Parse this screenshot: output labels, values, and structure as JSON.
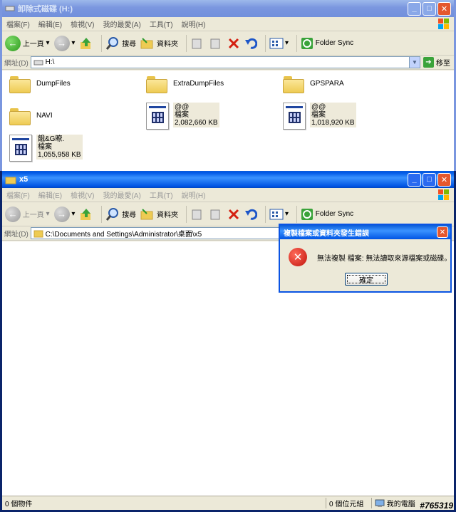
{
  "window1": {
    "title": "卸除式磁碟 (H:)",
    "menu": [
      "檔案(F)",
      "編輯(E)",
      "檢視(V)",
      "我的最愛(A)",
      "工具(T)",
      "說明(H)"
    ],
    "toolbar": {
      "back": "上一頁",
      "search": "搜尋",
      "folders": "資料夾",
      "folder_sync": "Folder Sync"
    },
    "address_label": "網址(D)",
    "address_value": "H:\\",
    "go_label": "移至",
    "items": [
      {
        "type": "folder",
        "name": "DumpFiles"
      },
      {
        "type": "folder",
        "name": "ExtraDumpFiles"
      },
      {
        "type": "folder",
        "name": "GPSPARA"
      },
      {
        "type": "folder",
        "name": "NAVI"
      },
      {
        "type": "file",
        "name": "@@",
        "kind": "檔案",
        "size": "2,082,660 KB"
      },
      {
        "type": "file",
        "name": "@@",
        "kind": "檔案",
        "size": "1,018,920 KB"
      },
      {
        "type": "file",
        "name": "餓&G瞭.",
        "kind": "檔案",
        "size": "1,055,958 KB"
      }
    ]
  },
  "window2": {
    "title": "x5",
    "menu": [
      "檔案(F)",
      "編輯(E)",
      "檢視(V)",
      "我的最愛(A)",
      "工具(T)",
      "說明(H)"
    ],
    "toolbar": {
      "back": "上一頁",
      "search": "搜尋",
      "folders": "資料夾",
      "folder_sync": "Folder Sync"
    },
    "address_label": "網址(D)",
    "address_value": "C:\\Documents and Settings\\Administrator\\桌面\\x5",
    "status": {
      "objects": "0 個物件",
      "size": "0 個位元組",
      "location": "我的電腦"
    }
  },
  "dialog": {
    "title": "複製檔案或資料夾發生錯誤",
    "message": "無法複製 檔案: 無法讀取來源檔案或磁碟。",
    "ok_label": "確定"
  },
  "watermark": "#765319"
}
